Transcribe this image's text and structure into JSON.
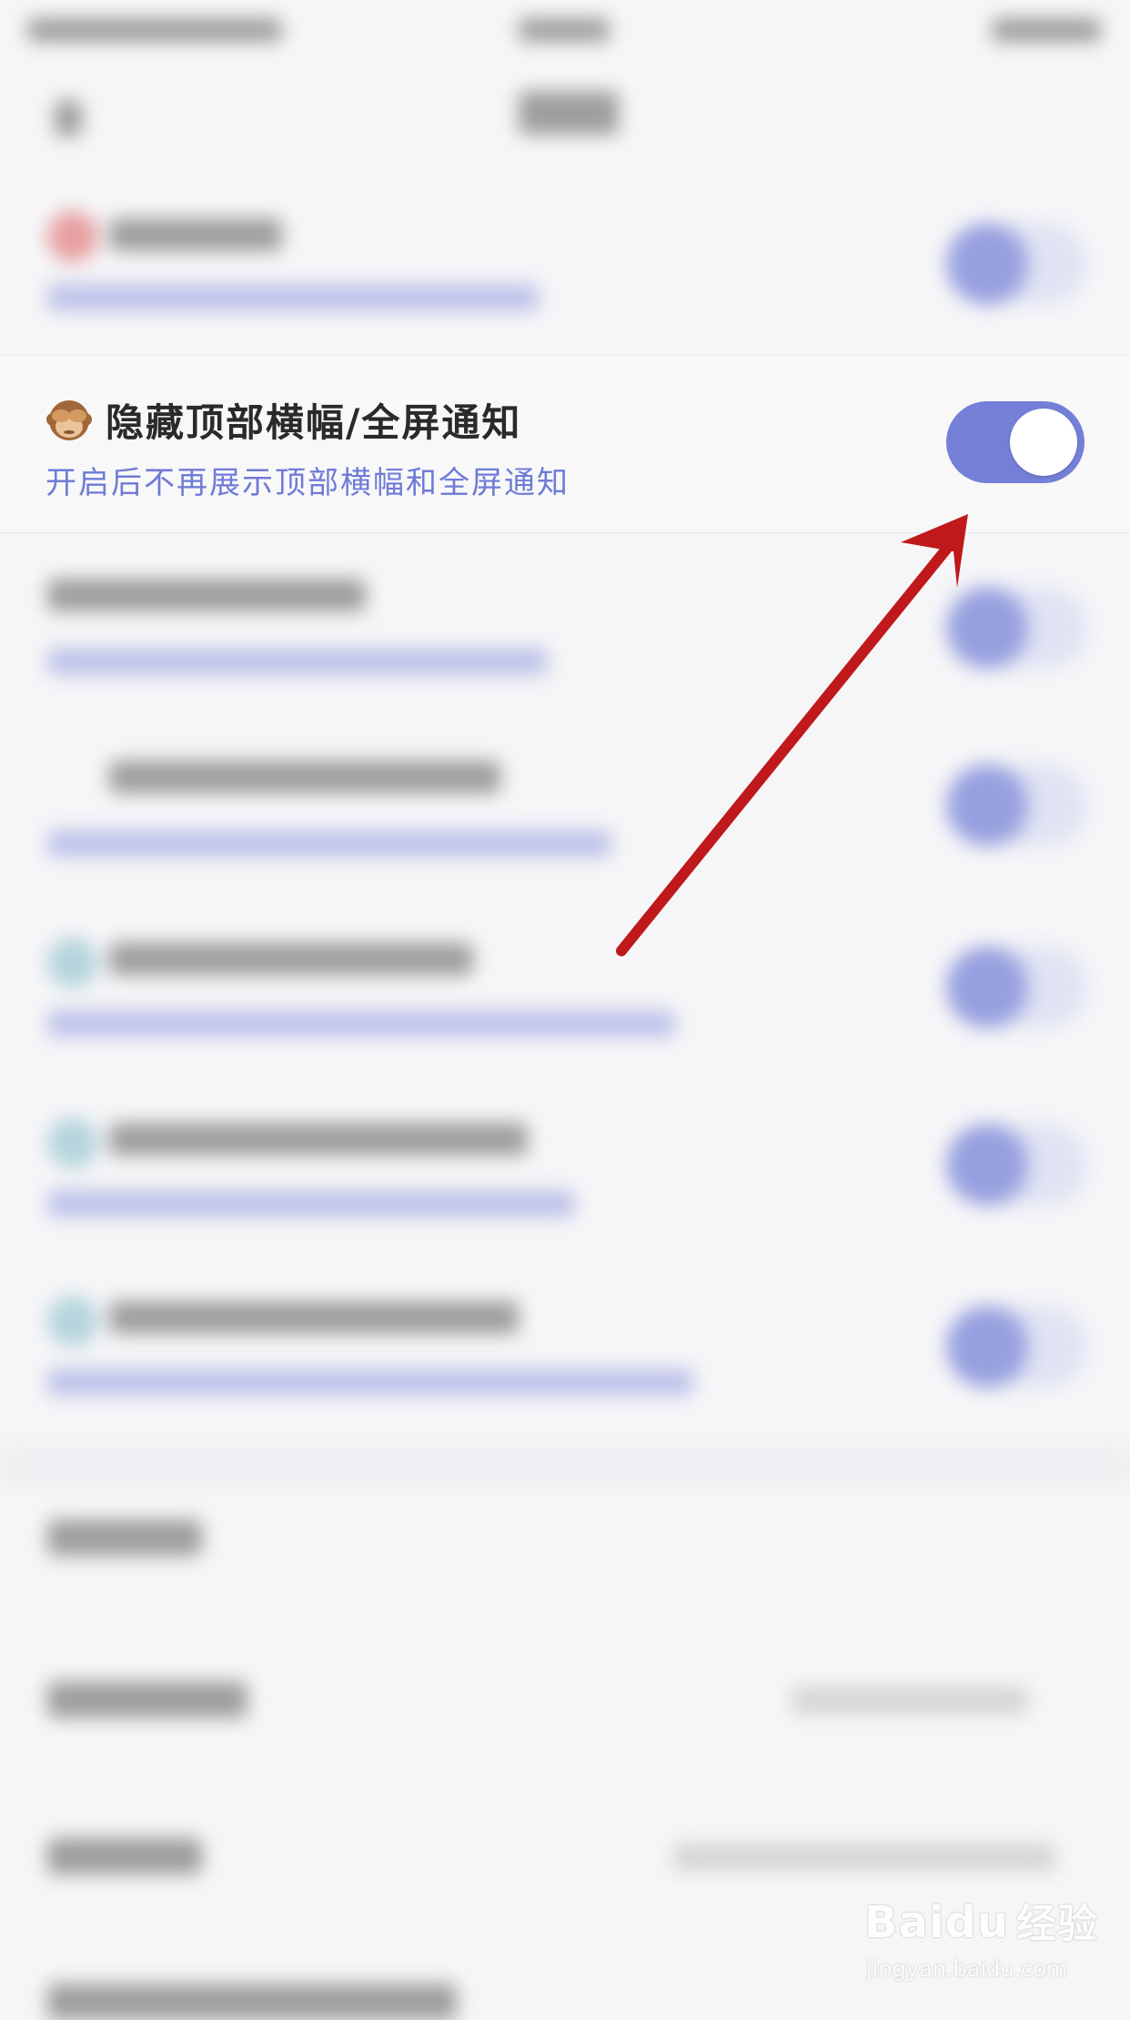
{
  "highlighted_setting": {
    "emoji": "🙈",
    "title": "隐藏顶部横幅/全屏通知",
    "subtitle": "开启后不再展示顶部横幅和全屏通知",
    "toggle_on": true
  },
  "watermark": {
    "brand": "Baidu",
    "brand_cn": "经验",
    "url": "jingyan.baidu.com"
  },
  "colors": {
    "accent": "#7480d8",
    "subtitle_text": "#6f7bd6",
    "arrow": "#c0191b",
    "background": "#f6f6f8"
  }
}
